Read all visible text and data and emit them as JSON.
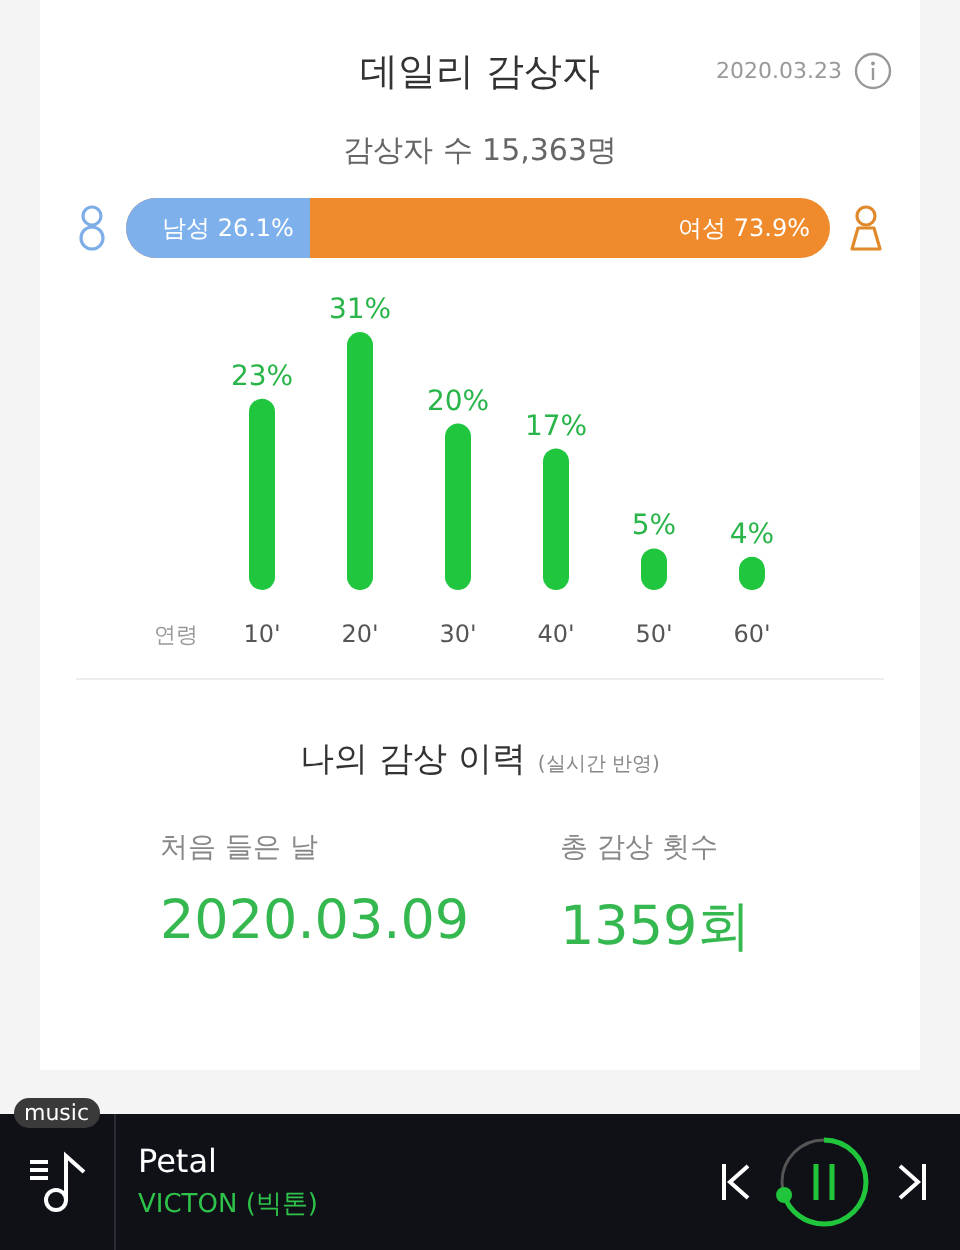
{
  "header": {
    "title": "데일리 감상자",
    "date": "2020.03.23"
  },
  "listeners": {
    "count_text": "감상자 수 15,363명"
  },
  "gender": {
    "male_label": "남성 26.1%",
    "female_label": "여성 73.9%",
    "level": 0.261
  },
  "age_chart": {
    "chart_data": {
      "type": "bar",
      "xlabel": "연령",
      "categories": [
        "10'",
        "20'",
        "30'",
        "40'",
        "50'",
        "60'"
      ],
      "values": [
        23,
        31,
        20,
        17,
        5,
        4
      ],
      "value_labels": [
        "23%",
        "31%",
        "20%",
        "17%",
        "5%",
        "4%"
      ]
    }
  },
  "history": {
    "title": "나의 감상 이력",
    "note": "(실시간 반영)",
    "stats": [
      {
        "label": "처음 들은 날",
        "value": "2020.03.09"
      },
      {
        "label": "총 감상 횟수",
        "value": "1359회"
      }
    ]
  },
  "player": {
    "badge": "music",
    "title": "Petal",
    "artist": "VICTON (빅톤)"
  }
}
